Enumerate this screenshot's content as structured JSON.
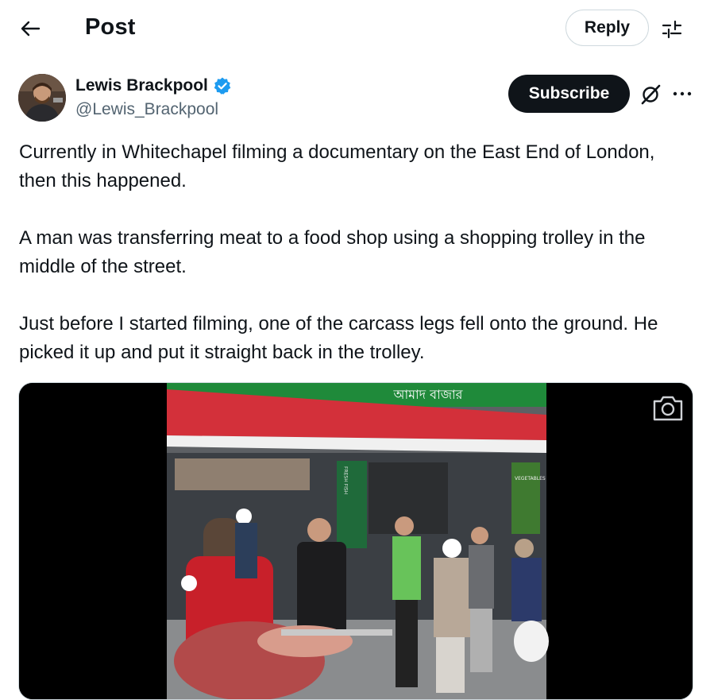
{
  "header": {
    "title": "Post",
    "reply_label": "Reply"
  },
  "author": {
    "name": "Lewis Brackpool",
    "handle": "@Lewis_Brackpool",
    "verified": true,
    "subscribe_label": "Subscribe"
  },
  "post": {
    "paragraphs": [
      "Currently in Whitechapel filming a documentary on the East End of London, then this happened.",
      "A man was transferring meat to a food shop using a shopping trolley in the middle of the street.",
      "Just before I started filming, one of the carcass legs fell onto the ground. He picked it up and put it straight back in the trolley."
    ]
  },
  "media": {
    "type": "video",
    "sign_text": "আমাদ বাজার",
    "fish_sign": "FRESH FISH",
    "veg_sign": "VEGETABLES"
  },
  "icons": {
    "back": "arrow-left-icon",
    "settings": "sliders-icon",
    "verified": "verified-badge-icon",
    "grok": "grok-icon",
    "more": "more-dots-icon",
    "camera": "camera-icon"
  },
  "colors": {
    "accent": "#1d9bf0",
    "text": "#0f1419",
    "muted": "#536471",
    "border": "#cfd9de",
    "awning": "#d3303a",
    "shop_sign": "#1f8a3a"
  }
}
